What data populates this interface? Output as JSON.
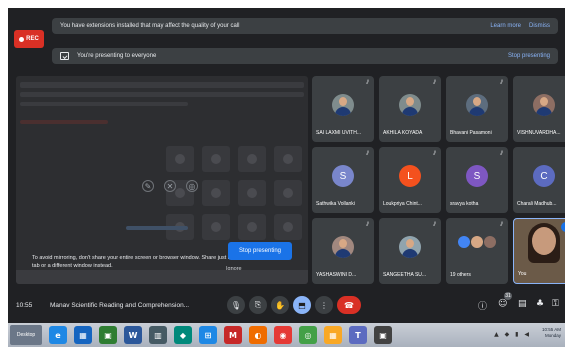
{
  "recording": {
    "label": "REC"
  },
  "extension_banner": {
    "text": "You have extensions installed that may affect the quality of your call",
    "learn_more": "Learn more",
    "dismiss": "Dismiss"
  },
  "presenting_banner": {
    "text": "You're presenting to everyone",
    "stop": "Stop presenting"
  },
  "share_overlay": {
    "warning": "To avoid mirroring, don't share your entire screen or browser window. Share just a tab or a different window instead.",
    "stop_button": "Stop presenting",
    "ignore": "Ignore"
  },
  "participants": [
    {
      "name": "SAI LAXMI UVITH...",
      "kind": "photo",
      "color": "#7f8c8d"
    },
    {
      "name": "AKHILA KOYADA",
      "kind": "photo",
      "color": "#7f8c8d"
    },
    {
      "name": "Bhavani Pasamoni",
      "kind": "photo",
      "color": "#5d6d7e"
    },
    {
      "name": "VISHNUVARDHA...",
      "kind": "photo",
      "color": "#8d6e63"
    },
    {
      "name": "Sathwika Vollanki",
      "kind": "letter",
      "letter": "S",
      "color": "#7986cb"
    },
    {
      "name": "Loukpriya Chint...",
      "kind": "letter",
      "letter": "L",
      "color": "#f4511e"
    },
    {
      "name": "sravya kotha",
      "kind": "letter",
      "letter": "S",
      "color": "#7e57c2"
    },
    {
      "name": "Charali Madhub...",
      "kind": "letter",
      "letter": "C",
      "color": "#5c6bc0"
    },
    {
      "name": "YASHASWINI D...",
      "kind": "photo",
      "color": "#a1887f"
    },
    {
      "name": "SANGEETHA SU...",
      "kind": "photo",
      "color": "#90a4ae"
    },
    {
      "name": "19 others",
      "kind": "others",
      "color": "#4285f4"
    },
    {
      "name": "You",
      "kind": "self",
      "color": "#6b5a48"
    }
  ],
  "meeting": {
    "time": "10:55",
    "title": "Manav Scientific Reading and Comprehension..."
  },
  "controls": {
    "mic": "🎙",
    "camera": "⎘",
    "hand": "✋",
    "present": "⬒",
    "more": "⋮",
    "leave": "☎"
  },
  "right_controls": {
    "info": "ⓘ",
    "people": "☺",
    "people_count": "31",
    "chat": "▤",
    "activities": "♣",
    "host": "⚿"
  },
  "taskbar": {
    "start": "Desktop",
    "apps": [
      "e",
      "▦",
      "▣",
      "W",
      "▥",
      "◆",
      "⊞",
      "M",
      "◐",
      "◉",
      "◎",
      "▦",
      "T",
      "▣"
    ],
    "app_colors": [
      "#1e88e5",
      "#1565c0",
      "#2e7d32",
      "#2b579a",
      "#455a64",
      "#00897b",
      "#1e88e5",
      "#c62828",
      "#ef6c00",
      "#e53935",
      "#43a047",
      "#f9a825",
      "#5c6bc0",
      "#424242"
    ],
    "tray_icons": "▲ ◆ ▮ ◀",
    "clock": "10:55 AM",
    "date": "Monday"
  }
}
